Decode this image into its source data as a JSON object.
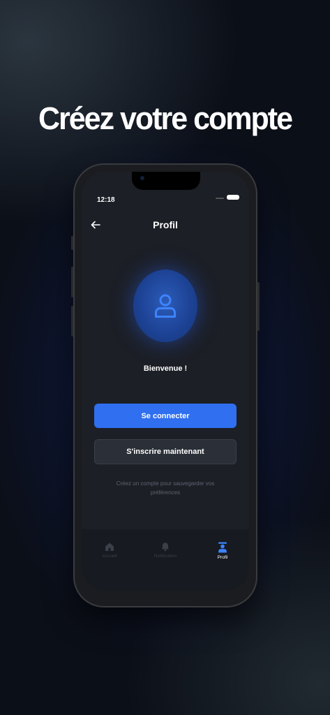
{
  "headline": "Créez votre compte",
  "status": {
    "time": "12:18"
  },
  "header": {
    "title": "Profil",
    "back_icon": "arrow-left-icon"
  },
  "avatar": {
    "icon": "user-icon",
    "color": "#2f6ff0"
  },
  "welcome": "Bienvenue !",
  "buttons": {
    "primary": "Se connecter",
    "secondary": "S'inscrire maintenant"
  },
  "hint": "Créez un compte pour sauvegarder vos préférences",
  "tabs": [
    {
      "label": "Accueil",
      "icon": "home-icon",
      "active": false
    },
    {
      "label": "Notification",
      "icon": "bell-icon",
      "active": false
    },
    {
      "label": "Profil",
      "icon": "profile-icon",
      "active": true
    }
  ],
  "colors": {
    "accent": "#2f6ff0",
    "screen_bg": "#1c1f26",
    "tabbar_bg": "#171a20"
  }
}
